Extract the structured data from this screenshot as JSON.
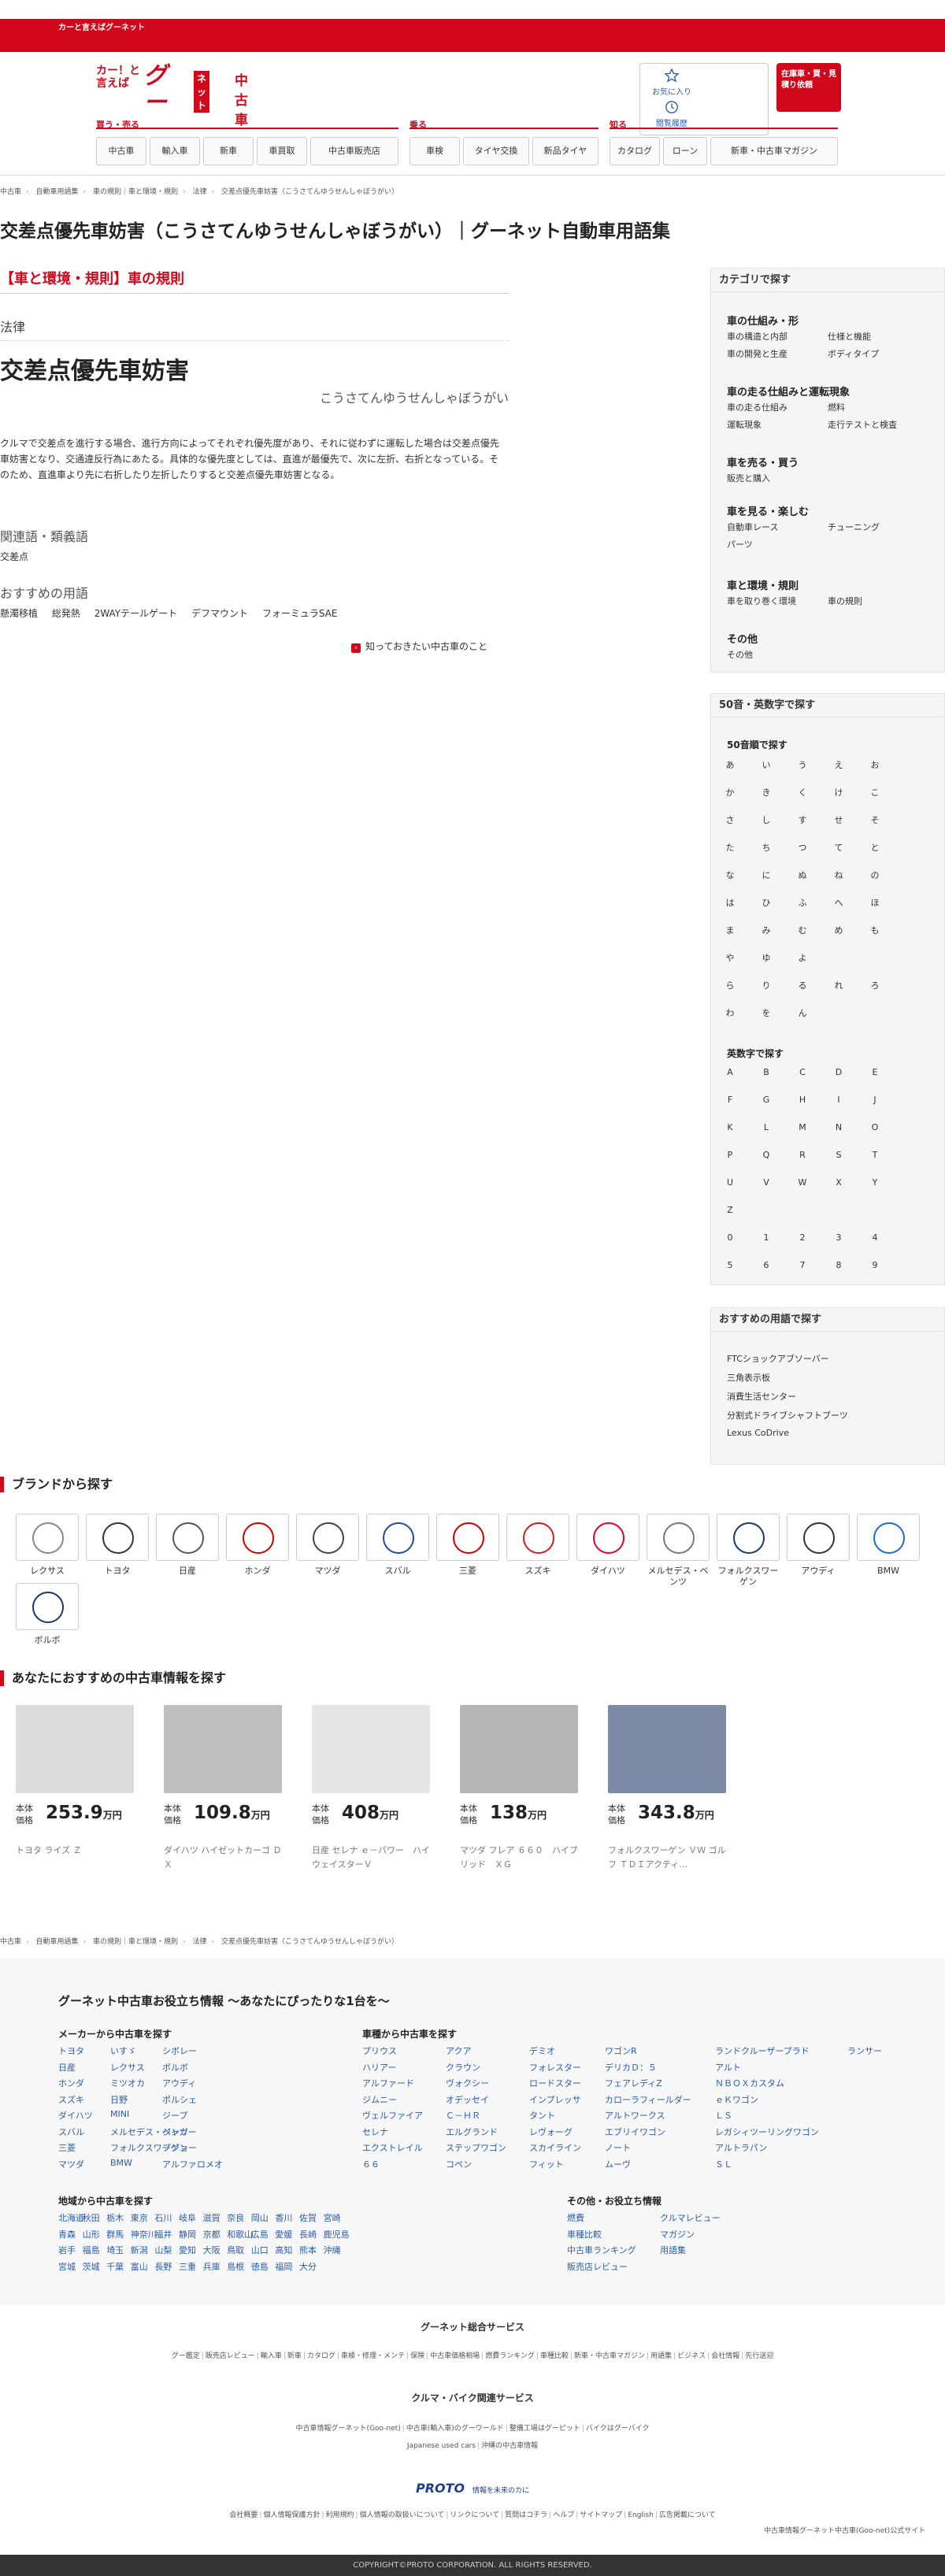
{
  "header": {
    "top_logo": "カーと言えばグーネット",
    "catch": "カー！と言えば",
    "goo": "グー",
    "net": "ネット",
    "used_car": "中古車",
    "favorite": "お気に入り",
    "history": "閲覧履歴",
    "stock_btn": "在庫車・買・見積り依頼",
    "groups": [
      {
        "label": "買う・売る"
      },
      {
        "label": "乗る"
      },
      {
        "label": "知る"
      }
    ],
    "nav": [
      "中古車",
      "輸入車",
      "新車",
      "車買取",
      "中古車販売店",
      "車検",
      "タイヤ交換",
      "新品タイヤ",
      "カタログ",
      "ローン",
      "新車・中古車マガジン"
    ]
  },
  "breadcrumb": [
    "中古車",
    "自動車用語集",
    "車の規則｜車と環境・規則",
    "法律",
    "交差点優先車妨害（こうさてんゆうせんしゃぼうがい）"
  ],
  "main": {
    "title": "交差点優先車妨害（こうさてんゆうせんしゃぼうがい）｜グーネット自動車用語集",
    "category": "【車と環境・規則】車の規則",
    "law_label": "法律",
    "term": "交差点優先車妨害",
    "reading": "こうさてんゆうせんしゃぼうがい",
    "description": "クルマで交差点を進行する場合、進行方向によってそれぞれ優先度があり、それに従わずに運転した場合は交差点優先車妨害となり、交通違反行為にあたる。具体的な優先度としては、直進が最優先で、次に左折、右折となっている。そのため、直進車より先に右折したり左折したりすると交差点優先車妨害となる。",
    "related_label": "関連語・類義語",
    "related": "交差点",
    "recommend_label": "おすすめの用語",
    "recommend": [
      "懸濁移植",
      "総発熱",
      "2WAYテールゲート",
      "デフマウント",
      "フォーミュラSAE"
    ],
    "know_link": "知っておきたい中古車のこと"
  },
  "sidebar": {
    "category_title": "カテゴリで探す",
    "groups": [
      {
        "title": "車の仕組み・形",
        "items": [
          "車の構造と内部",
          "仕様と機能",
          "車の開発と生産",
          "ボディタイプ"
        ]
      },
      {
        "title": "車の走る仕組みと運転現象",
        "items": [
          "車の走る仕組み",
          "燃料",
          "運転現象",
          "走行テストと検査"
        ]
      },
      {
        "title": "車を売る・買う",
        "items": [
          "販売と購入"
        ]
      },
      {
        "title": "車を見る・楽しむ",
        "items": [
          "自動車レース",
          "チューニング",
          "パーツ"
        ]
      },
      {
        "title": "車と環境・規則",
        "items": [
          "車を取り巻く環境",
          "車の規則"
        ]
      },
      {
        "title": "その他",
        "items": [
          "その他"
        ]
      }
    ],
    "index_title": "50音・英数字で探す",
    "kana_title": "50音順で探す",
    "kana": [
      [
        "あ",
        "い",
        "う",
        "え",
        "お"
      ],
      [
        "か",
        "き",
        "く",
        "け",
        "こ"
      ],
      [
        "さ",
        "し",
        "す",
        "せ",
        "そ"
      ],
      [
        "た",
        "ち",
        "つ",
        "て",
        "と"
      ],
      [
        "な",
        "に",
        "ぬ",
        "ね",
        "の"
      ],
      [
        "は",
        "ひ",
        "ふ",
        "へ",
        "ほ"
      ],
      [
        "ま",
        "み",
        "む",
        "め",
        "も"
      ],
      [
        "や",
        "ゆ",
        "よ"
      ],
      [
        "ら",
        "り",
        "る",
        "れ",
        "ろ"
      ],
      [
        "わ",
        "を",
        "ん"
      ]
    ],
    "alnum_title": "英数字で探す",
    "alnum": [
      [
        "A",
        "B",
        "C",
        "D",
        "E"
      ],
      [
        "F",
        "G",
        "H",
        "I",
        "J"
      ],
      [
        "K",
        "L",
        "M",
        "N",
        "O"
      ],
      [
        "P",
        "Q",
        "R",
        "S",
        "T"
      ],
      [
        "U",
        "V",
        "W",
        "X",
        "Y"
      ],
      [
        "Z"
      ],
      [
        "0",
        "1",
        "2",
        "3",
        "4"
      ],
      [
        "5",
        "6",
        "7",
        "8",
        "9"
      ]
    ],
    "rec_title": "おすすめの用語で探す",
    "rec_items": [
      "FTCショックアブソーバー",
      "三角表示板",
      "消費生活センター",
      "分割式ドライブシャフトブーツ",
      "Lexus CoDrive"
    ]
  },
  "brands": {
    "title": "ブランドから探す",
    "items": [
      {
        "name": "レクサス",
        "color": "#888888"
      },
      {
        "name": "トヨタ",
        "color": "#333333"
      },
      {
        "name": "日産",
        "color": "#555555"
      },
      {
        "name": "ホンダ",
        "color": "#cc0000"
      },
      {
        "name": "マツダ",
        "color": "#444444"
      },
      {
        "name": "スバル",
        "color": "#1f4a9c"
      },
      {
        "name": "三菱",
        "color": "#cc0000"
      },
      {
        "name": "スズキ",
        "color": "#d71920"
      },
      {
        "name": "ダイハツ",
        "color": "#e4002b"
      },
      {
        "name": "メルセデス・ベンツ",
        "color": "#777777"
      },
      {
        "name": "フォルクスワーゲン",
        "color": "#1d3769"
      },
      {
        "name": "アウディ",
        "color": "#333333"
      },
      {
        "name": "BMW",
        "color": "#1c69d4"
      },
      {
        "name": "ボルボ",
        "color": "#1d3769"
      }
    ]
  },
  "cars": {
    "title": "あなたにおすすめの中古車情報を探す",
    "price_label": "本体価格",
    "unit": "万円",
    "items": [
      {
        "price": "253.9",
        "name": "トヨタ ライズ Ｚ",
        "img": "#dcdcdc"
      },
      {
        "price": "109.8",
        "name": "ダイハツ ハイゼットカーゴ ＤＸ",
        "img": "#bfbfbf"
      },
      {
        "price": "408",
        "name": "日産 セレナ ｅ－パワー　ハイウェイスターＶ",
        "img": "#e6e6e6"
      },
      {
        "price": "138",
        "name": "マツダ フレア ６６０　ハイブリッド　ＸＧ",
        "img": "#b5b5b5"
      },
      {
        "price": "343.8",
        "name": "フォルクスワーゲン ＶＷ ゴルフ ＴＤＩアクティ…",
        "img": "#7c8aa8"
      }
    ]
  },
  "footer": {
    "guide_title": "グーネット中古車お役立ち情報 〜あなたにぴったりな1台を〜",
    "maker_title": "メーカーから中古車を探す",
    "makers": [
      [
        "トヨタ",
        "いすゞ",
        "シボレー"
      ],
      [
        "日産",
        "レクサス",
        "ボルボ"
      ],
      [
        "ホンダ",
        "ミツオカ",
        "アウディ"
      ],
      [
        "スズキ",
        "日野",
        "ポルシェ"
      ],
      [
        "ダイハツ",
        "MINI",
        "ジープ"
      ],
      [
        "スバル",
        "メルセデス・ベンツ",
        "ジャガー"
      ],
      [
        "三菱",
        "フォルクスワーゲン",
        "プジョー"
      ],
      [
        "マツダ",
        "BMW",
        "アルファロメオ"
      ]
    ],
    "model_title": "車種から中古車を探す",
    "models": [
      [
        "プリウス",
        "アクア",
        "デミオ",
        "ワゴンR",
        "ランドクルーザープラド",
        "ランサー"
      ],
      [
        "ハリアー",
        "クラウン",
        "フォレスター",
        "デリカＤ：５",
        "アルト"
      ],
      [
        "アルファード",
        "ヴォクシー",
        "ロードスター",
        "フェアレディZ",
        "ＮＢＯＸカスタム"
      ],
      [
        "ジムニー",
        "オデッセイ",
        "インプレッサ",
        "カローラフィールダー",
        "ｅＫワゴン"
      ],
      [
        "ヴェルファイア",
        "Ｃ－ＨＲ",
        "タント",
        "アルトワークス",
        "ＬＳ"
      ],
      [
        "セレナ",
        "エルグランド",
        "レヴォーグ",
        "エブリイワゴン",
        "レガシィツーリングワゴン"
      ],
      [
        "エクストレイル",
        "ステップワゴン",
        "スカイライン",
        "ノート",
        "アルトラパン"
      ],
      [
        "６６",
        "コペン",
        "フィット",
        "ムーヴ",
        "ＳＬ"
      ]
    ],
    "region_title": "地域から中古車を探す",
    "regions": [
      [
        "北海道",
        "秋田",
        "栃木",
        "東京",
        "石川",
        "岐阜",
        "滋賀",
        "奈良",
        "岡山",
        "香川",
        "佐賀",
        "宮崎"
      ],
      [
        "青森",
        "山形",
        "群馬",
        "神奈川",
        "福井",
        "静岡",
        "京都",
        "和歌山",
        "広島",
        "愛媛",
        "長崎",
        "鹿児島"
      ],
      [
        "岩手",
        "福島",
        "埼玉",
        "新潟",
        "山梨",
        "愛知",
        "大阪",
        "鳥取",
        "山口",
        "高知",
        "熊本",
        "沖縄"
      ],
      [
        "宮城",
        "茨城",
        "千葉",
        "富山",
        "長野",
        "三重",
        "兵庫",
        "島根",
        "徳島",
        "福岡",
        "大分"
      ]
    ],
    "other_title": "その他・お役立ち情報",
    "others": [
      [
        "燃費",
        "クルマレビュー"
      ],
      [
        "車種比較",
        "マガジン"
      ],
      [
        "中古車ランキング",
        "用語集"
      ],
      [
        "販売店レビュー"
      ]
    ],
    "svc1_title": "グーネット総合サービス",
    "svc1": [
      "グー鑑定",
      "販売店レビュー",
      "輸入車",
      "新車",
      "カタログ",
      "車検・修理・メンテ",
      "保険",
      "中古車価格相場",
      "燃費ランキング",
      "車種比較",
      "新車・中古車マガジン",
      "用語集",
      "ビジネス",
      "会社情報",
      "先行送迎"
    ],
    "svc2_title": "クルマ・バイク関連サービス",
    "svc2": [
      "中古車情報グーネット(Goo-net)",
      "中古車(輸入車)のグーワールド",
      "整備工場はグーピット",
      "バイクはグーバイク"
    ],
    "svc2b": [
      "Japanese used cars",
      "沖縄の中古車情報"
    ],
    "proto": "PROTO",
    "proto_tag": "情報を未来のカに",
    "links": [
      "会社概要",
      "個人情報保護方針",
      "利用規約",
      "個人情報の取扱いについて",
      "リンクについて",
      "質問はコチラ",
      "ヘルプ",
      "サイトマップ",
      "English",
      "広告掲載について"
    ],
    "site_note": "中古車情報グーネット中古車(Goo-net)公式サイト",
    "copyright": "COPYRIGHT©PROTO CORPORATION. ALL RIGHTS RESERVED."
  }
}
